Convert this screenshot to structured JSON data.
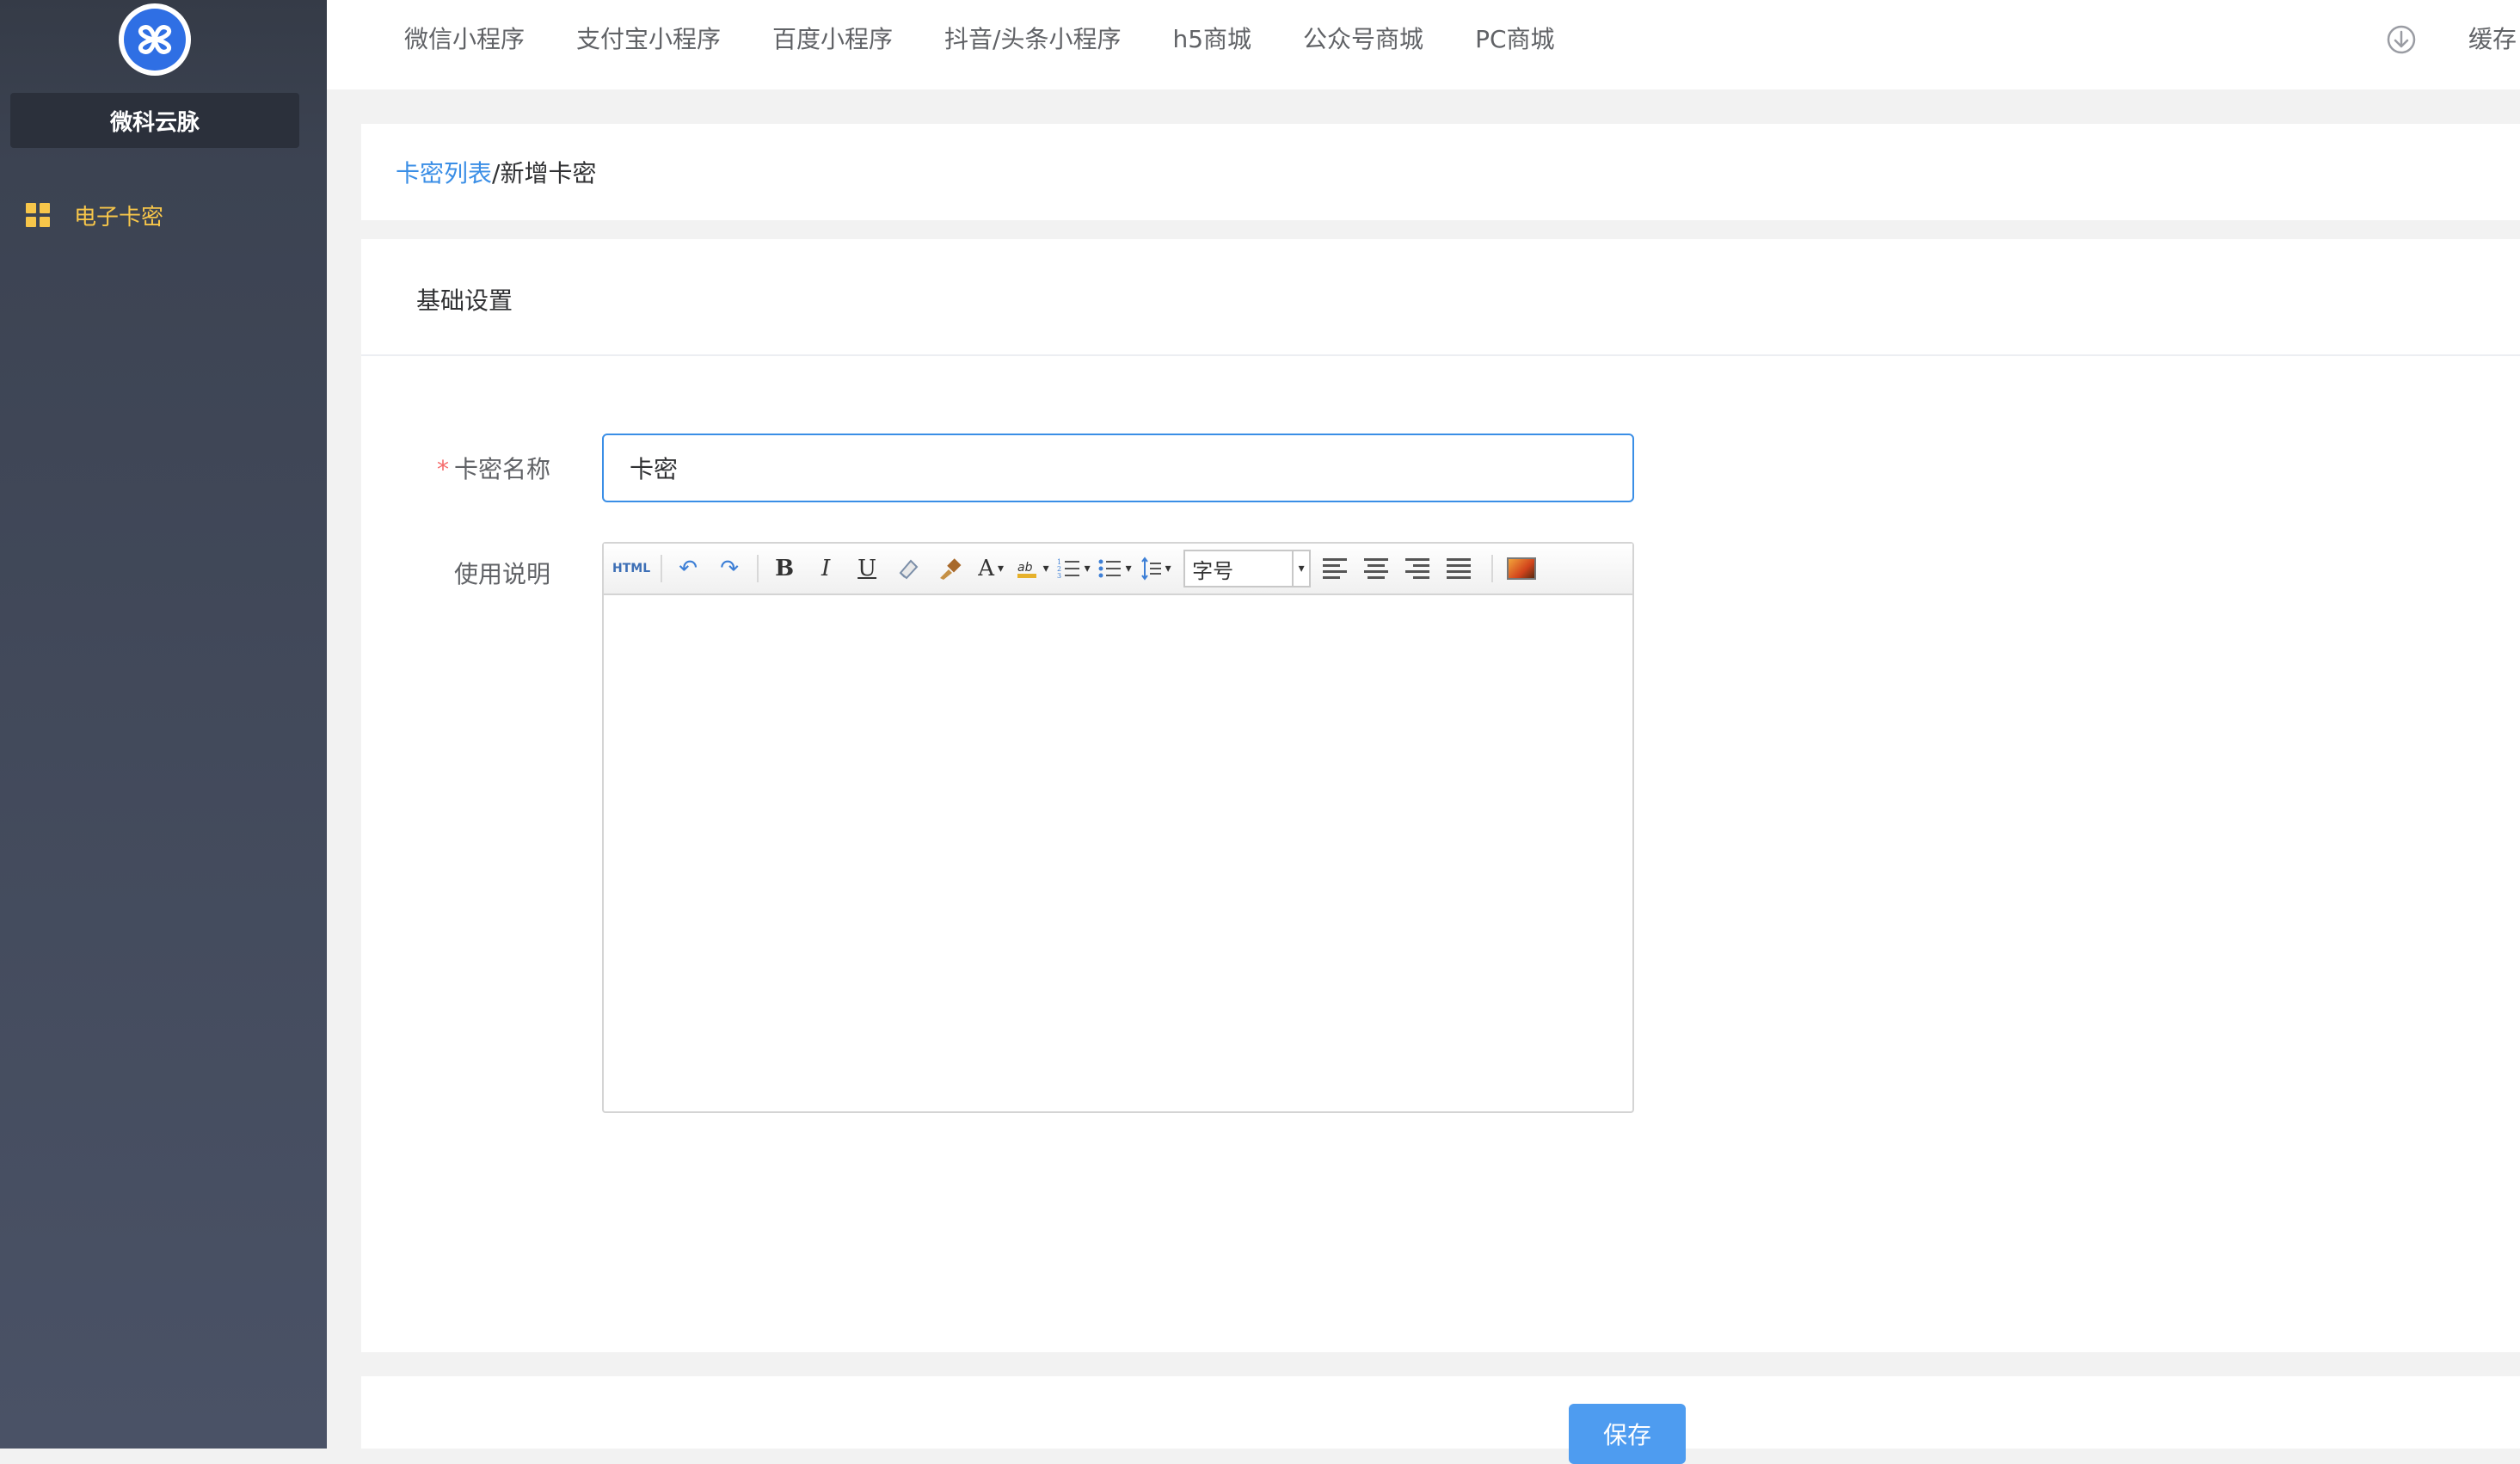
{
  "brand": {
    "name": "微科云脉"
  },
  "sidebar": {
    "items": [
      {
        "label": "电子卡密",
        "icon": "grid-icon",
        "active": true
      }
    ]
  },
  "topnav": {
    "items": [
      "微信小程序",
      "支付宝小程序",
      "百度小程序",
      "抖音/头条小程序",
      "h5商城",
      "公众号商城",
      "PC商城"
    ],
    "cache_label": "缓存"
  },
  "breadcrumb": {
    "parent": "卡密列表",
    "current": "/新增卡密"
  },
  "form": {
    "section_title": "基础设置",
    "name_label": "卡密名称",
    "required_mark": "*",
    "name_value": "卡密",
    "desc_label": "使用说明"
  },
  "editor": {
    "html_label": "HTML",
    "bold": "B",
    "italic": "I",
    "underline": "U",
    "font_color": "A",
    "fontsize_placeholder": "字号"
  },
  "actions": {
    "save_label": "保存"
  },
  "colors": {
    "accent": "#3a8ee6",
    "sidebar_active": "#f7c64a",
    "required": "#f56c6c"
  }
}
